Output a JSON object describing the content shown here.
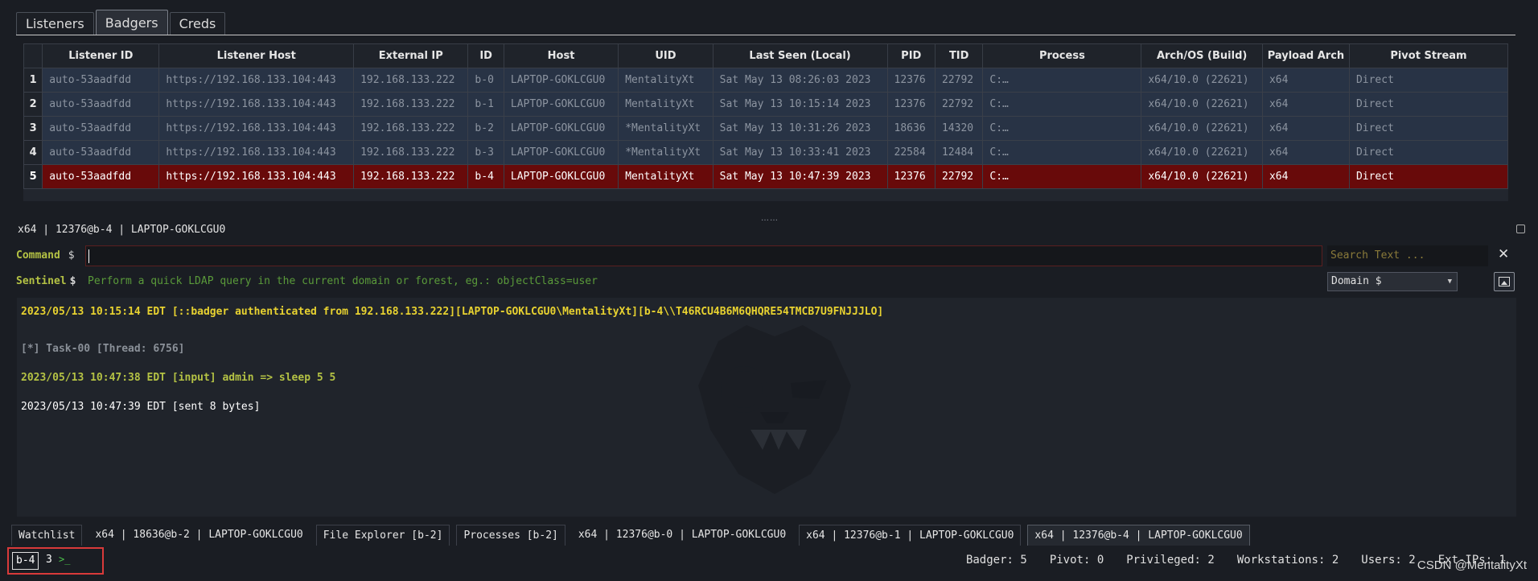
{
  "top_tabs": [
    {
      "label": "Listeners"
    },
    {
      "label": "Badgers"
    },
    {
      "label": "Creds"
    }
  ],
  "table": {
    "headers": [
      "",
      "Listener ID",
      "Listener Host",
      "External IP",
      "ID",
      "Host",
      "UID",
      "Last Seen (Local)",
      "PID",
      "TID",
      "Process",
      "Arch/OS (Build)",
      "Payload Arch",
      "Pivot Stream"
    ],
    "rows": [
      [
        "1",
        "auto-53aadfdd",
        "https://192.168.133.104:443",
        "192.168.133.222",
        "b-0",
        "LAPTOP-GOKLCGU0",
        "MentalityXt",
        "Sat May 13 08:26:03 2023",
        "12376",
        "22792",
        "C:…",
        "x64/10.0 (22621)",
        "x64",
        "Direct"
      ],
      [
        "2",
        "auto-53aadfdd",
        "https://192.168.133.104:443",
        "192.168.133.222",
        "b-1",
        "LAPTOP-GOKLCGU0",
        "MentalityXt",
        "Sat May 13 10:15:14 2023",
        "12376",
        "22792",
        "C:…",
        "x64/10.0 (22621)",
        "x64",
        "Direct"
      ],
      [
        "3",
        "auto-53aadfdd",
        "https://192.168.133.104:443",
        "192.168.133.222",
        "b-2",
        "LAPTOP-GOKLCGU0",
        "*MentalityXt",
        "Sat May 13 10:31:26 2023",
        "18636",
        "14320",
        "C:…",
        "x64/10.0 (22621)",
        "x64",
        "Direct"
      ],
      [
        "4",
        "auto-53aadfdd",
        "https://192.168.133.104:443",
        "192.168.133.222",
        "b-3",
        "LAPTOP-GOKLCGU0",
        "*MentalityXt",
        "Sat May 13 10:33:41 2023",
        "22584",
        "12484",
        "C:…",
        "x64/10.0 (22621)",
        "x64",
        "Direct"
      ],
      [
        "5",
        "auto-53aadfdd",
        "https://192.168.133.104:443",
        "192.168.133.222",
        "b-4",
        "LAPTOP-GOKLCGU0",
        "MentalityXt",
        "Sat May 13 10:47:39 2023",
        "12376",
        "22792",
        "C:…",
        "x64/10.0 (22621)",
        "x64",
        "Direct"
      ]
    ],
    "selected_row": 5
  },
  "splitter_glyph": "……",
  "session": {
    "label": "x64 | 12376@b-4 | LAPTOP-GOKLCGU0"
  },
  "command": {
    "label": "Command",
    "prompt": "$",
    "value": ""
  },
  "search": {
    "placeholder": "Search Text ..."
  },
  "close_glyph": "✕",
  "sentinel": {
    "label": "Sentinel",
    "prompt": "$",
    "placeholder": "Perform a quick LDAP query in the current domain or forest, eg.: objectClass=user"
  },
  "domain_select": {
    "value": "Domain $",
    "chevron": "▼"
  },
  "console": {
    "lines": [
      "2023/05/13 10:15:14 EDT [::badger authenticated from 192.168.133.222][LAPTOP-GOKLCGU0\\MentalityXt][b-4\\\\T46RCU4B6M6QHQRE54TMCB7U9FNJJJLO]",
      "[*] Task-00 [Thread: 6756]",
      "2023/05/13 10:47:38 EDT [input] admin => sleep 5 5",
      "2023/05/13 10:47:39 EDT [sent 8 bytes]"
    ]
  },
  "bottom_tabs": [
    {
      "label": "Watchlist"
    },
    {
      "label": "x64 | 18636@b-2 | LAPTOP-GOKLCGU0"
    },
    {
      "label": "File Explorer [b-2]"
    },
    {
      "label": "Processes [b-2]"
    },
    {
      "label": "x64 | 12376@b-0 | LAPTOP-GOKLCGU0"
    },
    {
      "label": "x64 | 12376@b-1 | LAPTOP-GOKLCGU0"
    },
    {
      "label": "x64 | 12376@b-4 | LAPTOP-GOKLCGU0"
    }
  ],
  "status": {
    "badger_id": "b-4",
    "count": "3",
    "prompt": ">_",
    "badger": "Badger: 5",
    "pivot": "Pivot: 0",
    "privileged": "Privileged: 2",
    "workstations": "Workstations: 2",
    "users": "Users: 2",
    "ext_ips": "Ext-IPs: 1"
  },
  "credit": "CSDN @MentalityXt",
  "colors": {
    "selected_row": "#680a0a",
    "row": "#283345",
    "command_label": "#b4c244",
    "highlight_box": "#d93a3a"
  }
}
